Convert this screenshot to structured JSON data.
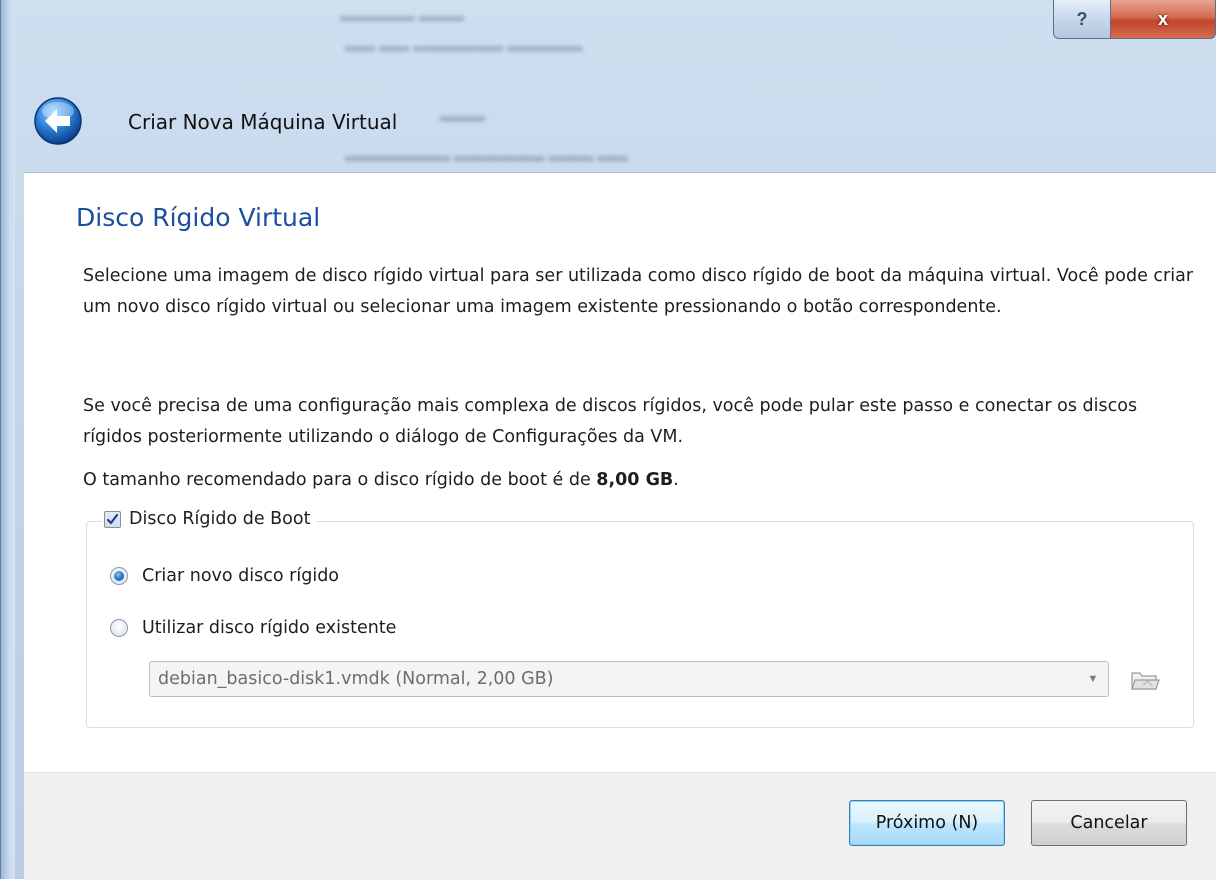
{
  "window": {
    "help_glyph": "?",
    "close_glyph": "x"
  },
  "wizard": {
    "title": "Criar Nova Máquina Virtual",
    "heading": "Disco Rígido Virtual",
    "paragraph1": "Selecione uma imagem de disco rígido virtual para ser utilizada como disco rígido de boot da máquina virtual. Você pode criar um novo disco rígido virtual ou selecionar uma imagem existente pressionando o botão correspondente.",
    "paragraph2": "Se você precisa de uma configuração mais complexa de discos rígidos, você pode pular este passo e conectar os discos rígidos posteriormente utilizando o diálogo de Configurações da VM.",
    "recommend_prefix": "O tamanho recomendado para o disco rígido de boot é de ",
    "recommend_size": "8,00 GB",
    "recommend_suffix": "."
  },
  "boot_disk": {
    "checkbox_label": "Disco Rígido de Boot",
    "checked": true,
    "option_create": "Criar novo disco rígido",
    "option_create_selected": true,
    "option_existing": "Utilizar disco rígido existente",
    "option_existing_selected": false,
    "existing_disk_value": "debian_basico-disk1.vmdk (Normal, 2,00 GB)"
  },
  "footer": {
    "next_label": "Próximo (N)",
    "cancel_label": "Cancelar"
  },
  "icons": {
    "back": "back-arrow-icon",
    "folder": "folder-open-icon",
    "dropdown": "chevron-down-icon",
    "check": "checkmark-icon"
  },
  "colors": {
    "heading_blue": "#1c4ea0",
    "titlebar": "#c3d6ea",
    "close_red": "#c0452c",
    "default_button_border": "#3c7fb1"
  }
}
